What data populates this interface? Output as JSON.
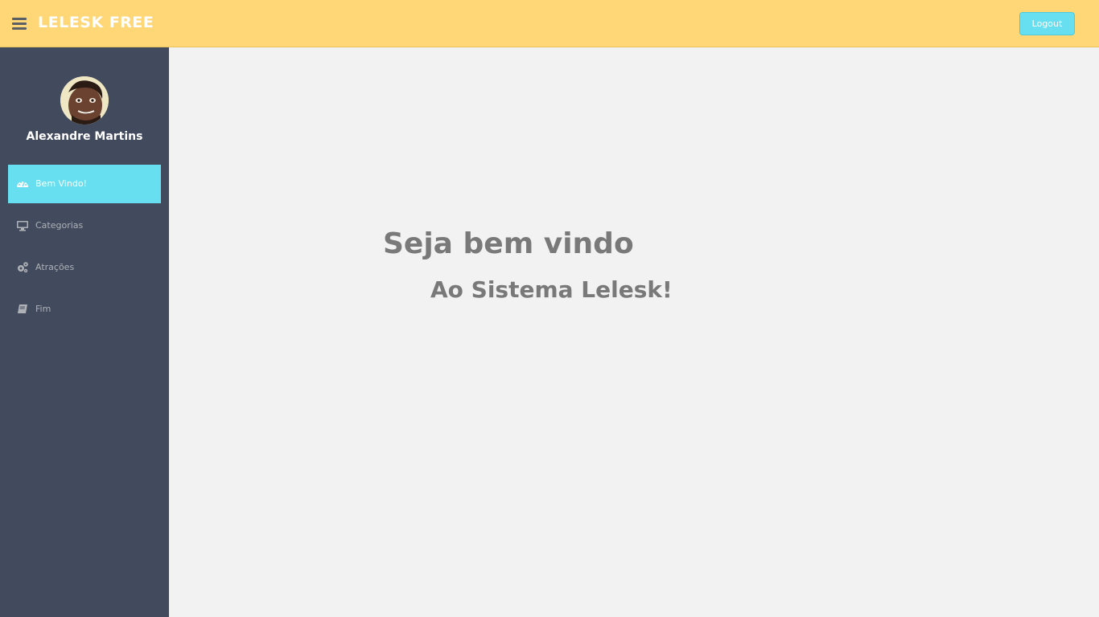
{
  "header": {
    "brand": "LELESK FREE",
    "logout_label": "Logout",
    "menu_icon": "hamburger-menu-icon"
  },
  "sidebar": {
    "username": "Alexandre Martins",
    "items": [
      {
        "label": "Bem Vindo!",
        "icon": "dashboard-icon",
        "active": true
      },
      {
        "label": "Categorias",
        "icon": "desktop-icon",
        "active": false
      },
      {
        "label": "Atrações",
        "icon": "cogs-icon",
        "active": false
      },
      {
        "label": "Fim",
        "icon": "book-icon",
        "active": false
      }
    ]
  },
  "main": {
    "title": "Seja bem vindo",
    "subtitle": "Ao Sistema Lelesk!"
  },
  "colors": {
    "header_bg": "#ffd777",
    "sidebar_bg": "#424a5d",
    "accent": "#68dff0",
    "content_bg": "#f2f2f2",
    "text_gray": "#797979"
  }
}
